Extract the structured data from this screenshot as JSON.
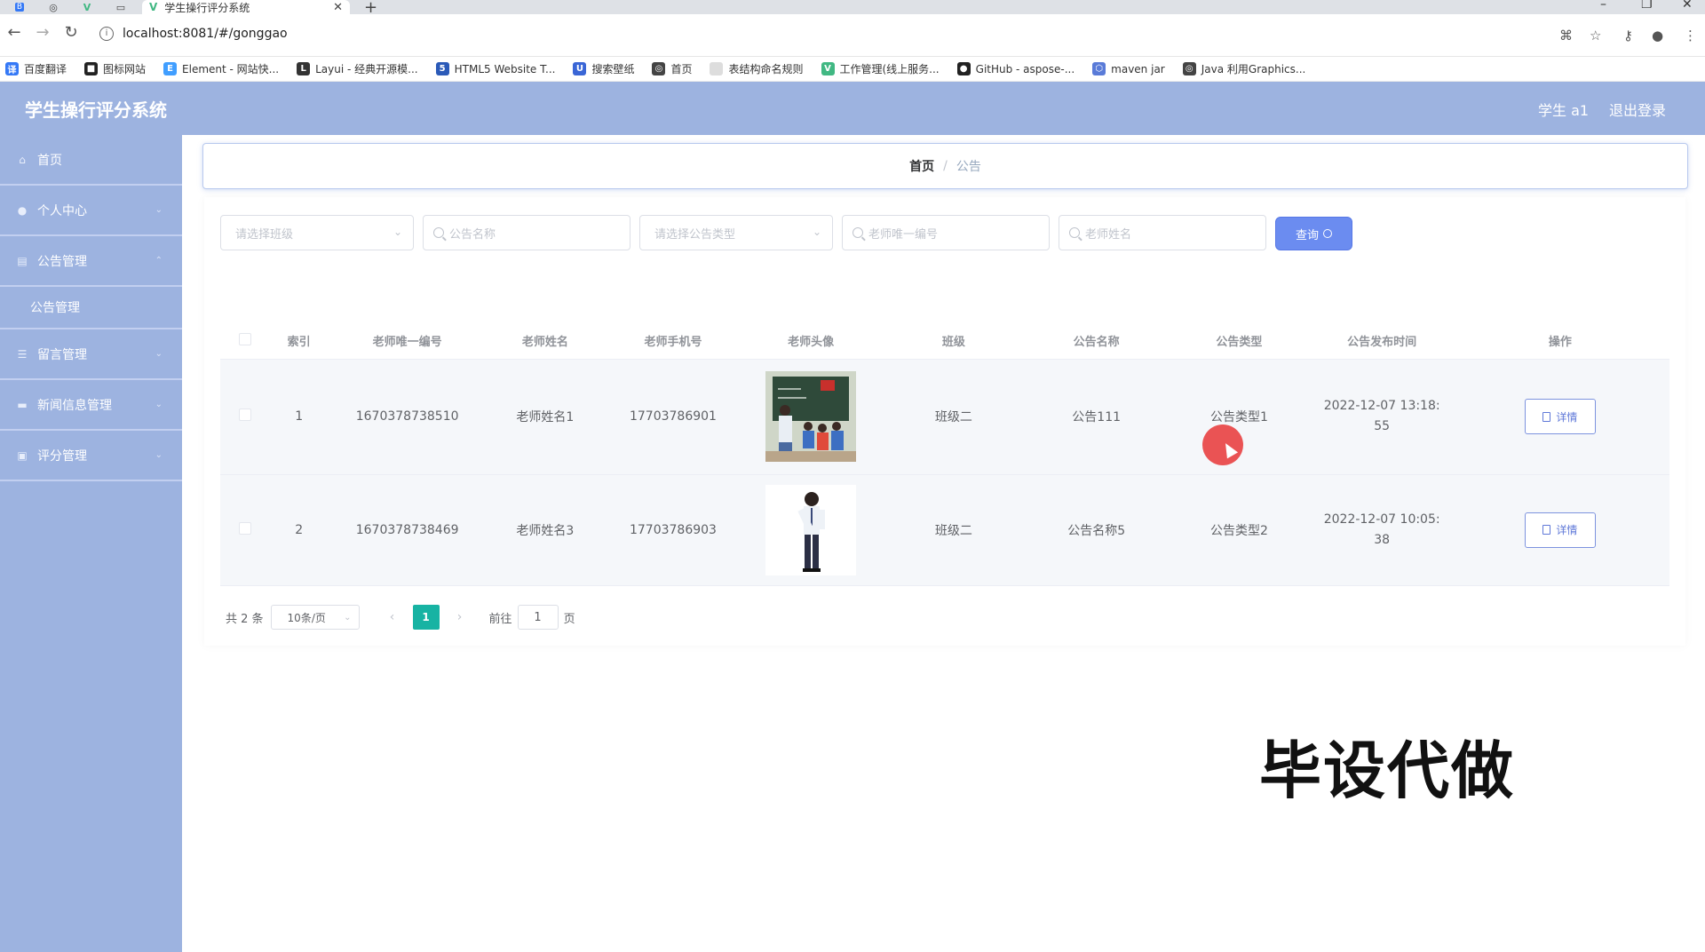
{
  "browser": {
    "tab_title": "学生操行评分系统",
    "url": "localhost:8081/#/gonggao",
    "bookmarks": [
      {
        "label": "百度翻译",
        "icon": "baidu-translate-icon",
        "color": "#3478f6"
      },
      {
        "label": "图标网站",
        "icon": "icon-site-icon",
        "color": "#222222"
      },
      {
        "label": "Element - 网站快...",
        "icon": "element-icon",
        "color": "#409eff"
      },
      {
        "label": "Layui - 经典开源模...",
        "icon": "layui-icon",
        "color": "#333333"
      },
      {
        "label": "HTML5 Website T...",
        "icon": "html5-icon",
        "color": "#2b5ab8"
      },
      {
        "label": "搜索壁纸",
        "icon": "wallpaper-icon",
        "color": "#3a66d6"
      },
      {
        "label": "首页",
        "icon": "globe-icon",
        "color": "#444444"
      },
      {
        "label": "表结构命名规则",
        "icon": "page-icon",
        "color": "#dddddd"
      },
      {
        "label": "工作管理(线上服务...",
        "icon": "vue-icon",
        "color": "#41b883"
      },
      {
        "label": "GitHub - aspose-...",
        "icon": "github-icon",
        "color": "#222222"
      },
      {
        "label": "maven jar",
        "icon": "hex-icon",
        "color": "#5a7bd8"
      },
      {
        "label": "Java 利用Graphics...",
        "icon": "globe-icon",
        "color": "#444444"
      }
    ]
  },
  "header": {
    "title": "学生操行评分系统",
    "user": "学生 a1",
    "logout": "退出登录"
  },
  "sidebar": {
    "items": [
      {
        "label": "首页",
        "icon": "home-icon"
      },
      {
        "label": "个人中心",
        "icon": "user-icon"
      },
      {
        "label": "公告管理",
        "icon": "notice-icon"
      },
      {
        "label": "公告管理",
        "icon": ""
      },
      {
        "label": "留言管理",
        "icon": "message-icon"
      },
      {
        "label": "新闻信息管理",
        "icon": "news-icon"
      },
      {
        "label": "评分管理",
        "icon": "score-icon"
      }
    ]
  },
  "breadcrumb": {
    "home": "首页",
    "sep": "/",
    "current": "公告"
  },
  "filters": {
    "class_placeholder": "请选择班级",
    "name_placeholder": "公告名称",
    "type_placeholder": "请选择公告类型",
    "teacher_id_placeholder": "老师唯一编号",
    "teacher_name_placeholder": "老师姓名",
    "query_label": "查询"
  },
  "table": {
    "headers": [
      "索引",
      "老师唯一编号",
      "老师姓名",
      "老师手机号",
      "老师头像",
      "班级",
      "公告名称",
      "公告类型",
      "公告发布时间",
      "操作"
    ],
    "rows": [
      {
        "index": "1",
        "teacher_id": "1670378738510",
        "teacher_name": "老师姓名1",
        "phone": "17703786901",
        "class": "班级二",
        "notice_name": "公告111",
        "notice_type": "公告类型1",
        "time_line1": "2022-12-07 13:18:",
        "time_line2": "55",
        "action": "详情"
      },
      {
        "index": "2",
        "teacher_id": "1670378738469",
        "teacher_name": "老师姓名3",
        "phone": "17703786903",
        "class": "班级二",
        "notice_name": "公告名称5",
        "notice_type": "公告类型2",
        "time_line1": "2022-12-07 10:05:",
        "time_line2": "38",
        "action": "详情"
      }
    ]
  },
  "pagination": {
    "total": "共 2 条",
    "page_size": "10条/页",
    "current_page": "1",
    "goto_prefix": "前往",
    "goto_value": "1",
    "goto_suffix": "页"
  },
  "watermark": "毕设代做",
  "colors": {
    "header_bg": "#9db3e0",
    "query_button": "#6b8cf0",
    "pager_active": "#17b3a3"
  }
}
